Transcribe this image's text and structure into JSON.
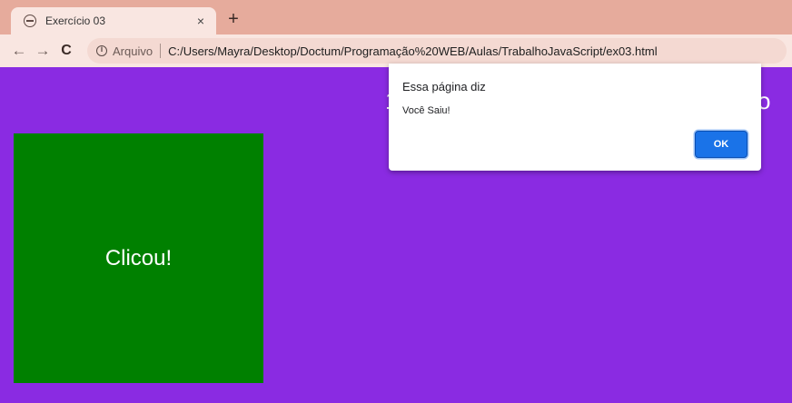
{
  "browser": {
    "tab": {
      "title": "Exercício 03",
      "close_label": "×"
    },
    "new_tab_label": "+",
    "nav": {
      "back": "←",
      "forward": "→",
      "reload": "C"
    },
    "address": {
      "security_label": "Arquivo",
      "url": "C:/Users/Mayra/Desktop/Doctum/Programação%20WEB/Aulas/TrabalhoJavaScript/ex03.html"
    }
  },
  "page": {
    "background_color": "#8a2be2",
    "box": {
      "text": "Clicou!",
      "color": "#008000"
    },
    "heading_fragment_left": "1",
    "heading_fragment_right": "o"
  },
  "dialog": {
    "title": "Essa página diz",
    "message": "Você Saiu!",
    "ok_label": "OK"
  }
}
